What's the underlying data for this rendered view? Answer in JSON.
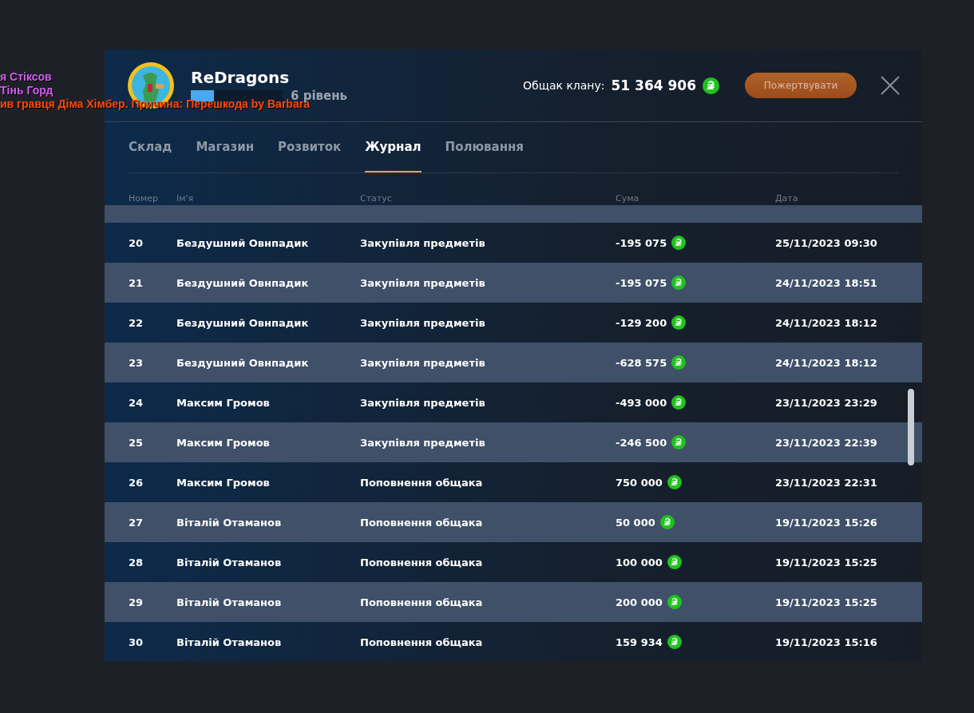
{
  "chat": [
    {
      "text": "я Стіксов",
      "color": "#d35cf0"
    },
    {
      "text": "Тінь Горд",
      "color": "#d35cf0"
    },
    {
      "text": "ив гравця Діма Хімбер. Причина: Перешкода by Barbara",
      "color": "#ff4a0a"
    }
  ],
  "clan": {
    "name": "ReDragons",
    "level": 0.25,
    "level_text": "6 рівень"
  },
  "treasury": {
    "label": "Общак клану:",
    "amount": "51 364 906"
  },
  "donate_button": "Пожертвувати",
  "tabs": [
    {
      "label": "Склад",
      "selected": false
    },
    {
      "label": "Магазин",
      "selected": false
    },
    {
      "label": "Розвиток",
      "selected": false
    },
    {
      "label": "Журнал",
      "selected": true
    },
    {
      "label": "Полювання",
      "selected": false
    }
  ],
  "table": {
    "columns": [
      "Номер",
      "Ім'я",
      "Статус",
      "Сума",
      "Дата"
    ],
    "rows": [
      {
        "number": "20",
        "name": "Бездушний Овнпадик",
        "status": "Закупівля предметів",
        "sum": "-195 075",
        "date": "25/11/2023 09:30"
      },
      {
        "number": "21",
        "name": "Бездушний Овнпадик",
        "status": "Закупівля предметів",
        "sum": "-195 075",
        "date": "24/11/2023 18:51"
      },
      {
        "number": "22",
        "name": "Бездушний Овнпадик",
        "status": "Закупівля предметів",
        "sum": "-129 200",
        "date": "24/11/2023 18:12"
      },
      {
        "number": "23",
        "name": "Бездушний Овнпадик",
        "status": "Закупівля предметів",
        "sum": "-628 575",
        "date": "24/11/2023 18:12"
      },
      {
        "number": "24",
        "name": "Максим Громов",
        "status": "Закупівля предметів",
        "sum": "-493 000",
        "date": "23/11/2023 23:29"
      },
      {
        "number": "25",
        "name": "Максим Громов",
        "status": "Закупівля предметів",
        "sum": "-246 500",
        "date": "23/11/2023 22:39"
      },
      {
        "number": "26",
        "name": "Максим Громов",
        "status": "Поповнення общака",
        "sum": "750 000",
        "date": "23/11/2023 22:31"
      },
      {
        "number": "27",
        "name": "Віталій Отаманов",
        "status": "Поповнення общака",
        "sum": "50 000",
        "date": "19/11/2023 15:26"
      },
      {
        "number": "28",
        "name": "Віталій Отаманов",
        "status": "Поповнення общака",
        "sum": "100 000",
        "date": "19/11/2023 15:25"
      },
      {
        "number": "29",
        "name": "Віталій Отаманов",
        "status": "Поповнення общака",
        "sum": "200 000",
        "date": "19/11/2023 15:25"
      },
      {
        "number": "30",
        "name": "Віталій Отаманов",
        "status": "Поповнення общака",
        "sum": "159 934",
        "date": "19/11/2023 15:16"
      }
    ]
  }
}
